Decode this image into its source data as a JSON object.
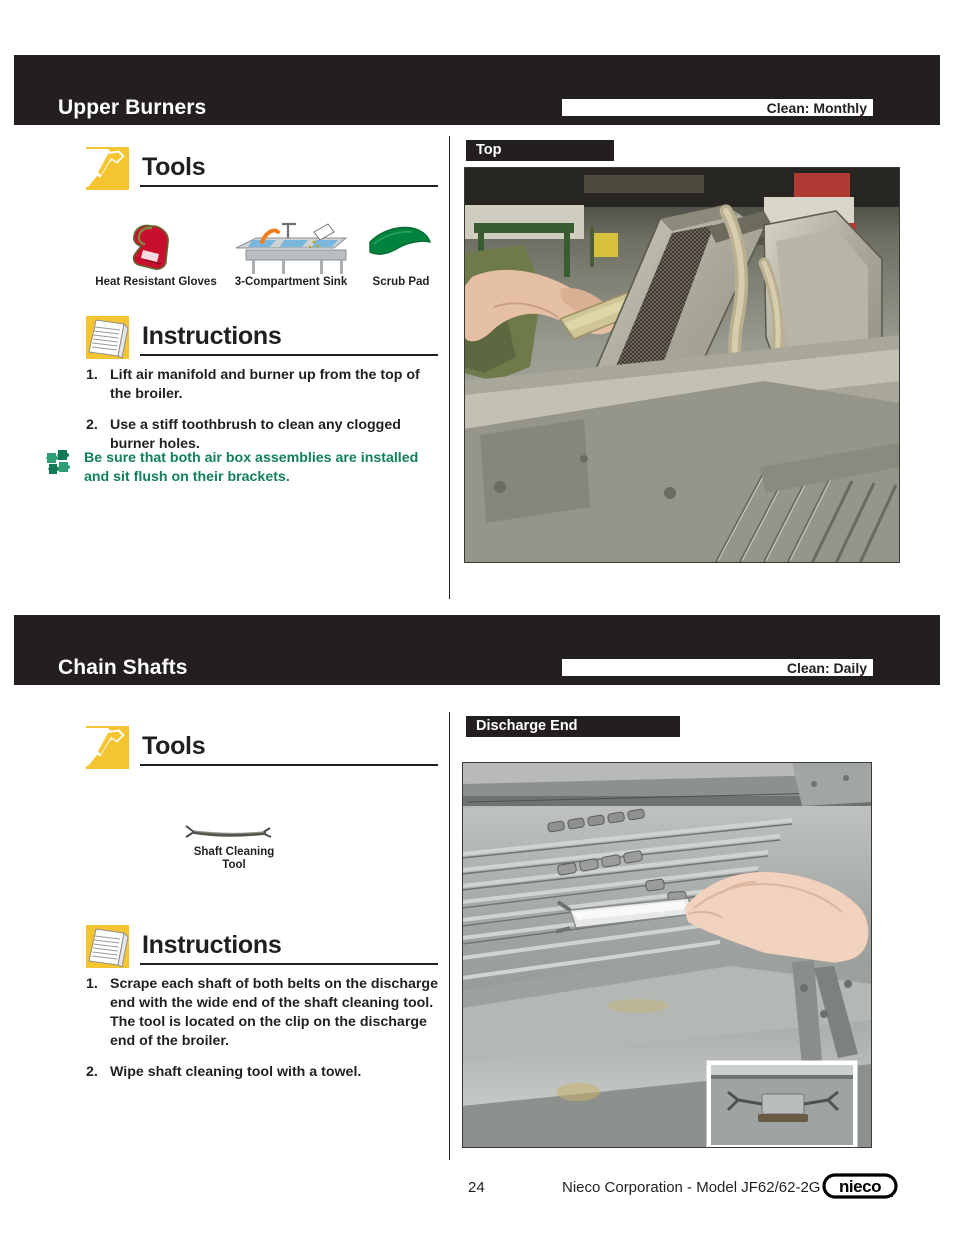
{
  "page": {
    "number": "24",
    "footer_text": "Nieco Corporation - Model JF62/62-2G",
    "logo_text": "nieco"
  },
  "colors": {
    "band": "#231f20",
    "accent_yellow": "#f5c431",
    "note_green": "#11805c"
  },
  "sections": [
    {
      "title": "Upper Burners",
      "clean_label": "Clean: Monthly",
      "tools_heading": "Tools",
      "instructions_heading": "Instructions",
      "tools": [
        {
          "name": "Heat Resistant Gloves",
          "icon": "gloves-icon"
        },
        {
          "name": "3-Compartment Sink",
          "icon": "sink-icon"
        },
        {
          "name": "Scrub Pad",
          "icon": "scrub-pad-icon"
        }
      ],
      "steps": [
        {
          "num": "1.",
          "text": "Lift air manifold and burner up from the top of the broiler."
        },
        {
          "num": "2.",
          "text": "Use a stiff toothbrush to clean any clogged burner holes."
        }
      ],
      "note": "Be sure that both air box assemblies are installed and sit flush on their brackets.",
      "photo_label": "Top"
    },
    {
      "title": "Chain Shafts",
      "clean_label": "Clean: Daily",
      "tools_heading": "Tools",
      "instructions_heading": "Instructions",
      "tools": [
        {
          "name": "Shaft Cleaning\nTool",
          "icon": "shaft-cleaning-tool-icon"
        }
      ],
      "steps": [
        {
          "num": "1.",
          "text": "Scrape each shaft of both belts on the discharge end with the wide end of the shaft cleaning tool. The tool is located on the clip on the discharge end of the broiler."
        },
        {
          "num": "2.",
          "text": "Wipe shaft cleaning tool with a towel."
        }
      ],
      "photo_label": "Discharge End"
    }
  ]
}
